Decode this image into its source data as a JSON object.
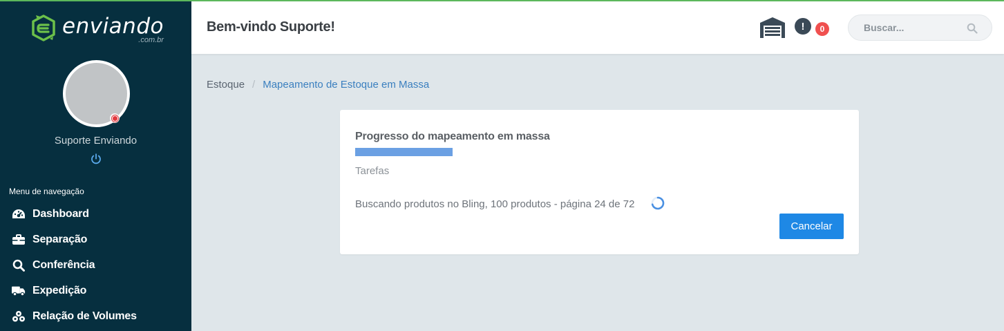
{
  "colors": {
    "sidebar_bg": "#062f3f",
    "brand_green": "#6cc04a",
    "accent_blue": "#1e88e5",
    "progress_blue": "#6ba0e3",
    "badge_red": "#f0504f"
  },
  "brand": {
    "name": "enviando",
    "domain": ".com.br"
  },
  "user": {
    "name": "Suporte Enviando",
    "status": "offline"
  },
  "sidebar": {
    "nav_title": "Menu de navegação",
    "items": [
      {
        "label": "Dashboard",
        "icon": "dashboard-icon"
      },
      {
        "label": "Separação",
        "icon": "briefcase-icon"
      },
      {
        "label": "Conferência",
        "icon": "search-icon"
      },
      {
        "label": "Expedição",
        "icon": "truck-icon"
      },
      {
        "label": "Relação de Volumes",
        "icon": "boxes-icon"
      }
    ]
  },
  "header": {
    "title": "Bem-vindo Suporte!",
    "alert_count": "0",
    "search_placeholder": "Buscar..."
  },
  "breadcrumb": {
    "root": "Estoque",
    "separator": "/",
    "current": "Mapeamento de Estoque em Massa"
  },
  "card": {
    "title": "Progresso do mapeamento em massa",
    "progress_fraction": 0.2,
    "tasks_label": "Tarefas",
    "status_text": "Buscando produtos no Bling, 100 produtos - página 24 de 72",
    "cancel_label": "Cancelar"
  }
}
